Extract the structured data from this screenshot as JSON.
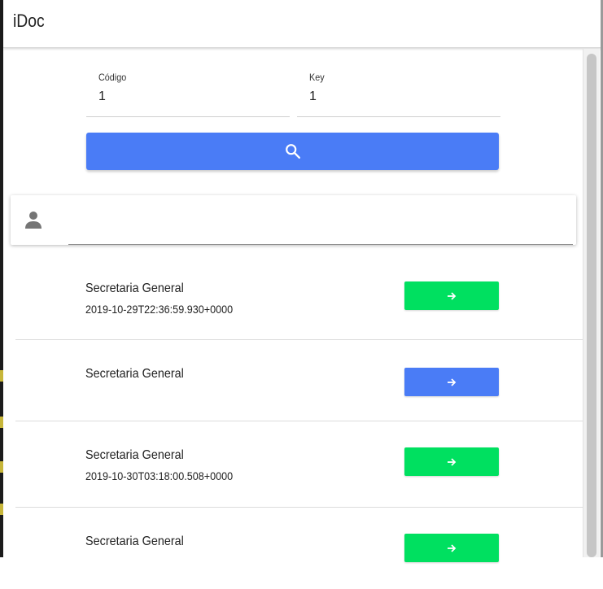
{
  "app": {
    "title": "iDoc"
  },
  "form": {
    "codigo_label": "Código",
    "codigo_value": "1",
    "key_label": "Key",
    "key_value": "1"
  },
  "search_button": {
    "icon": "search-icon",
    "color": "#4a7cf6"
  },
  "user_card": {
    "icon": "person-icon"
  },
  "documents": [
    {
      "name": "Secretaria General",
      "date": "2019-10-29T22:36:59.930+0000",
      "button_icon": "arrow-right-icon",
      "button_color": "#00e060"
    },
    {
      "name": "Secretaria General",
      "date": "",
      "button_icon": "arrow-right-icon",
      "button_color": "#4a7cf6"
    },
    {
      "name": "Secretaria General",
      "date": "2019-10-30T03:18:00.508+0000",
      "button_icon": "arrow-right-icon",
      "button_color": "#00e060"
    },
    {
      "name": "Secretaria General",
      "date": "",
      "button_icon": "arrow-right-icon",
      "button_color": "#00e060"
    }
  ]
}
